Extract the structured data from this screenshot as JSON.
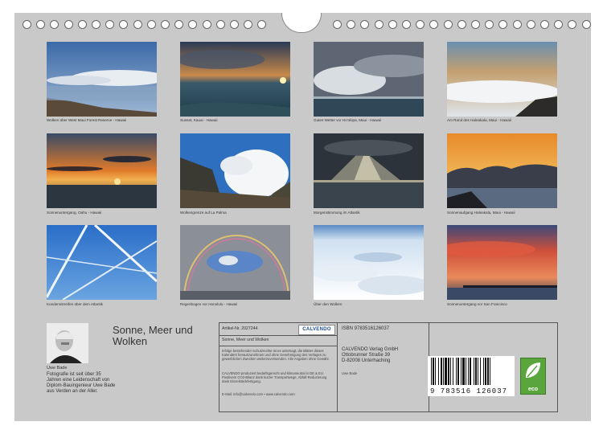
{
  "calendar": {
    "title": "Sonne, Meer und Wolken",
    "photos": [
      {
        "caption": "Wolken über West Maui Forest Reserve - Hawaii",
        "scene": "mountain-clouds"
      },
      {
        "caption": "Sunset, Kauai - Hawaii",
        "scene": "sunset-sea"
      },
      {
        "caption": "Gutes Wetter vor Ho'okipa, Maui - Hawaii",
        "scene": "storm-clouds"
      },
      {
        "caption": "Am Rand des Haleakala, Maui - Hawaii",
        "scene": "above-clouds"
      },
      {
        "caption": "Sonnenuntergang, Oahu - Hawaii",
        "scene": "orange-sunset"
      },
      {
        "caption": "Wolkengrenze auf La Palma",
        "scene": "cloud-boundary"
      },
      {
        "caption": "Morgenstimmung im Atlantik",
        "scene": "sunrays"
      },
      {
        "caption": "Sonnenaufgang Haleakala, Maui - Hawaii",
        "scene": "golden-clouds"
      },
      {
        "caption": "Kondensstreifen über dem Atlantik",
        "scene": "contrails"
      },
      {
        "caption": "Regenbogen vor Honolulu - Hawaii",
        "scene": "rainbow"
      },
      {
        "caption": "Über den Wolken",
        "scene": "cloud-sea"
      },
      {
        "caption": "Sonnenuntergang vor San Francisco",
        "scene": "red-sky"
      }
    ]
  },
  "author": {
    "name": "Uwe Bade",
    "bio": "Fotografie ist seit über 35 Jahren eine Leidenschaft von Diplom-Bauingenieur Uwe Bade aus Verden an der Aller."
  },
  "info": {
    "artikel": "Artikel-Nr. 2027244",
    "calvendo_logo": "CALVENDO",
    "title": "Sonne, Meer und Wolken",
    "legal1": "Infolge bestehender Schutzrechte ist es untersagt, die Blätter dieses Kalenders herauszunehmen und ohne Genehmigung des Verlages zu gewerblichen Zwecken weiterzuverwenden. Alle Angaben ohne Gewähr.",
    "legal2": "CALVENDO produziert bedarfsgerecht und klimaneutral in DE & EU. Positivem CO2-Bilanz dank kurzer Transportwege, Abfall-Reduzierung dank Einzelstückfertigung.",
    "contact": "E-Mail: info@calvendo.com • www.calvendo.com",
    "isbn": "ISBN 9783516126037",
    "publisher": [
      "CALVENDO Verlag GmbH",
      "Ottobrunner Straße 39",
      "D-82008 Unterhaching"
    ],
    "author_small": "Uwe Bade",
    "barcode_number": "9 783516 126037",
    "eco_label": "eco"
  }
}
